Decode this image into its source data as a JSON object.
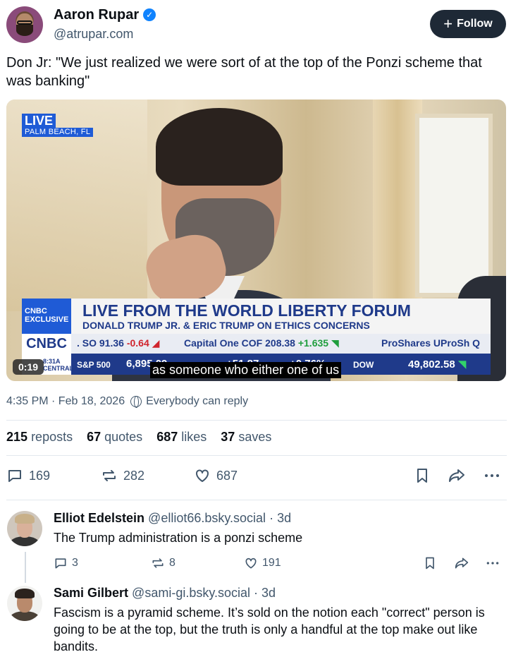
{
  "author": {
    "name": "Aaron Rupar",
    "handle": "@atrupar.com",
    "follow_label": "Follow"
  },
  "post": {
    "text": "Don Jr: \"We just realized we were sort of at the top of the Ponzi scheme that was banking\"",
    "timestamp": "4:35 PM · Feb 18, 2026",
    "reply_setting": "Everybody can reply",
    "stats": {
      "reposts_count": "215",
      "reposts_label": "reposts",
      "quotes_count": "67",
      "quotes_label": "quotes",
      "likes_count": "687",
      "likes_label": "likes",
      "saves_count": "37",
      "saves_label": "saves"
    },
    "actions": {
      "replies": "169",
      "reposts": "282",
      "likes": "687"
    }
  },
  "video": {
    "live": "LIVE",
    "location": "PALM BEACH, FL",
    "exclusive": "CNBC EXCLUSIVE",
    "headline": "LIVE FROM THE WORLD LIBERTY FORUM",
    "subheadline": "DONALD TRUMP JR. & ERIC TRUMP ON ETHICS CONCERNS",
    "network": "CNBC",
    "ticker": {
      "t1_name": ". SO 91.36",
      "t1_change": "-0.64",
      "t2_name": "Capital One COF 208.38",
      "t2_change": "+1.635",
      "t3_name": "ProShares UProSh Q",
      "central": "8:31A CENTRAL",
      "sp_label": "S&P 500",
      "sp_value": "6,895.09",
      "mid_value": "+51.87",
      "pct_value": "+0.76%",
      "dow_label": "DOW",
      "dow_value": "49,802.58"
    },
    "caption": "as someone who either one of us",
    "timecode": "0:19"
  },
  "replies": [
    {
      "name": "Elliot Edelstein",
      "handle": "@elliot66.bsky.social",
      "age": "· 3d",
      "text": "The Trump administration is a ponzi scheme",
      "replies": "3",
      "reposts": "8",
      "likes": "191"
    },
    {
      "name": "Sami Gilbert",
      "handle": "@sami-gi.bsky.social",
      "age": "· 3d",
      "text": "Fascism is a pyramid scheme. It’s sold on the notion each \"correct\" person is going to be at the top, but the truth is only a handful at the top make out like bandits."
    }
  ],
  "colors": {
    "follow_bg": "#1e2936",
    "verified": "#1083fe",
    "secondary_text": "#42576c",
    "cnbc_blue": "#1f3a8a"
  }
}
